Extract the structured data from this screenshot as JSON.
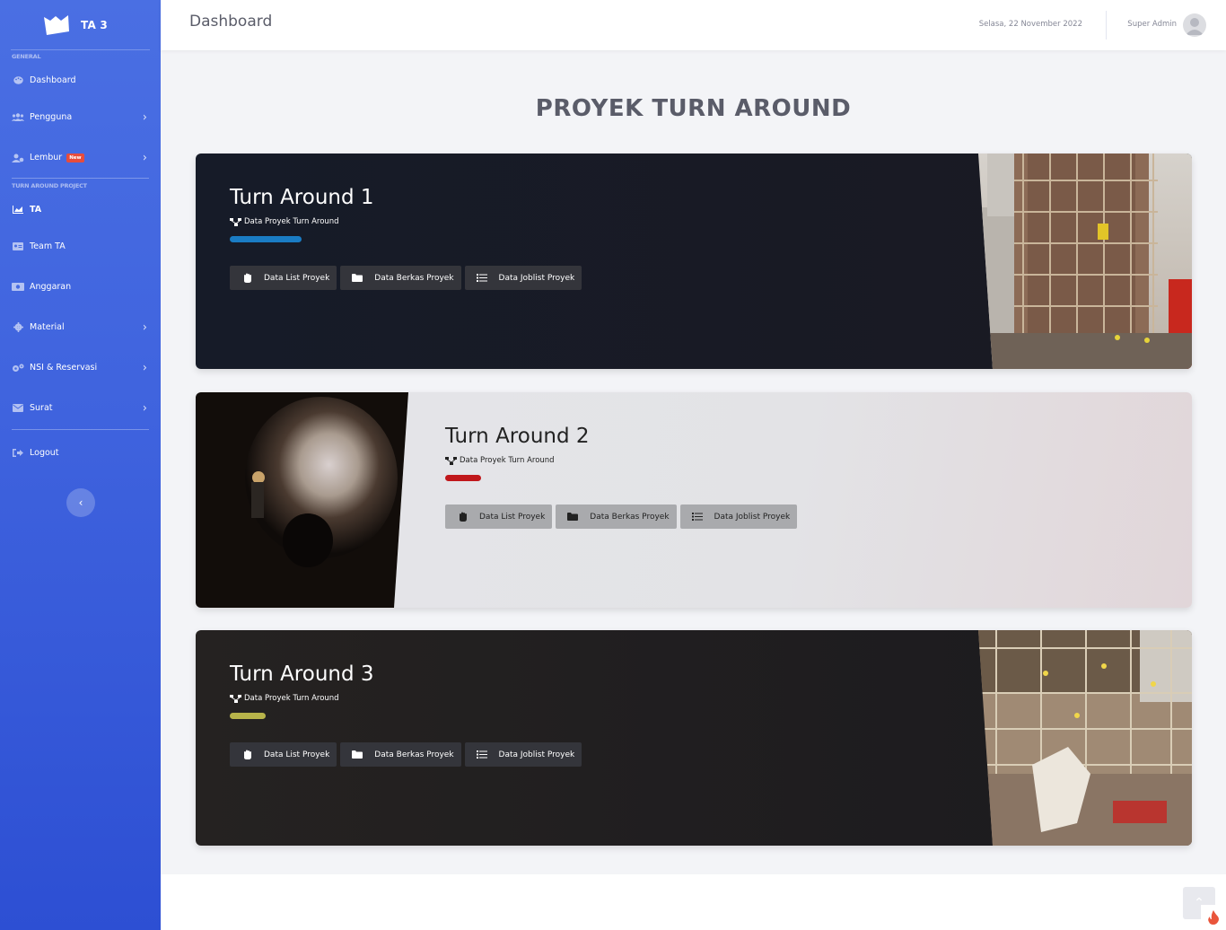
{
  "app": {
    "brand": "TA 3"
  },
  "sidebar": {
    "heading_general": "GENERAL",
    "heading_project": "TURN AROUND PROJECT",
    "items": [
      {
        "label": "Dashboard",
        "icon": "palette-icon"
      },
      {
        "label": "Pengguna",
        "icon": "users-icon"
      },
      {
        "label": "Lembur",
        "icon": "user-cog-icon",
        "badge": "New"
      },
      {
        "label": "TA",
        "icon": "chart-area-icon"
      },
      {
        "label": "Team TA",
        "icon": "id-card-icon"
      },
      {
        "label": "Anggaran",
        "icon": "money-icon"
      },
      {
        "label": "Material",
        "icon": "gear-icon"
      },
      {
        "label": "NSI & Reservasi",
        "icon": "gears-icon"
      },
      {
        "label": "Surat",
        "icon": "envelope-icon"
      },
      {
        "label": "Logout",
        "icon": "sign-out-icon"
      }
    ]
  },
  "topbar": {
    "title": "Dashboard",
    "date": "Selasa, 22 November 2022",
    "user": "Super Admin"
  },
  "page": {
    "heading": "PROYEK TURN AROUND"
  },
  "cards": [
    {
      "title": "Turn Around 1",
      "subtitle": "Data Proyek Turn Around",
      "bar_color": "#1a7cc4",
      "buttons": [
        "Data List Proyek",
        "Data Berkas Proyek",
        "Data Joblist Proyek"
      ]
    },
    {
      "title": "Turn Around 2",
      "subtitle": "Data Proyek Turn Around",
      "bar_color": "#c0171b",
      "buttons": [
        "Data List Proyek",
        "Data Berkas Proyek",
        "Data Joblist Proyek"
      ]
    },
    {
      "title": "Turn Around 3",
      "subtitle": "Data Proyek Turn Around",
      "bar_color": "#b8b44a",
      "buttons": [
        "Data List Proyek",
        "Data Berkas Proyek",
        "Data Joblist Proyek"
      ]
    }
  ],
  "colors": {
    "sidebar_top": "#4a6fe3",
    "sidebar_bottom": "#2d4fd3",
    "badge_red": "#e74c3c"
  }
}
